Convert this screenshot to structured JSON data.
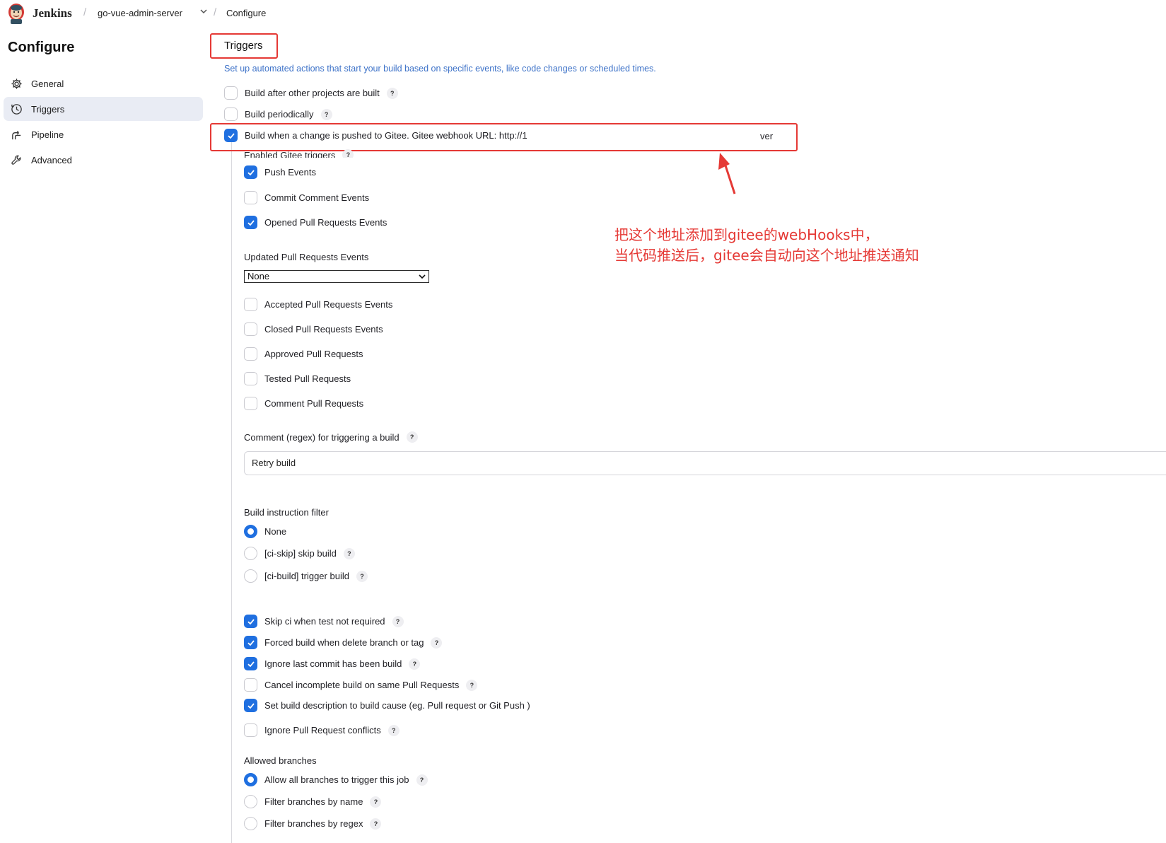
{
  "header": {
    "brand": "Jenkins",
    "project": "go-vue-admin-server",
    "page": "Configure"
  },
  "sidebar": {
    "title": "Configure",
    "items": [
      {
        "label": "General",
        "icon": "gear-icon"
      },
      {
        "label": "Triggers",
        "icon": "clock-icon",
        "active": true
      },
      {
        "label": "Pipeline",
        "icon": "pipeline-icon"
      },
      {
        "label": "Advanced",
        "icon": "wrench-icon"
      }
    ]
  },
  "triggers": {
    "title": "Triggers",
    "description": "Set up automated actions that start your build based on specific events, like code changes or scheduled times.",
    "build_after_other": "Build after other projects are built",
    "build_periodically": "Build periodically",
    "gitee_webhook": "Build when a change is pushed to Gitee. Gitee webhook URL: http://1",
    "gitee_webhook_tail": "ver",
    "enabled_triggers_label": "Enabled Gitee triggers",
    "push_events": "Push Events",
    "commit_comment_events": "Commit Comment Events",
    "opened_pr_events": "Opened Pull Requests Events",
    "updated_pr_label": "Updated Pull Requests Events",
    "updated_pr_value": "None",
    "accepted_pr": "Accepted Pull Requests Events",
    "closed_pr": "Closed Pull Requests Events",
    "approved_pr": "Approved Pull Requests",
    "tested_pr": "Tested Pull Requests",
    "comment_pr": "Comment Pull Requests",
    "comment_regex_label": "Comment (regex) for triggering a build",
    "comment_regex_value": "Retry build",
    "build_filter_label": "Build instruction filter",
    "filter_none": "None",
    "filter_ci_skip": "[ci-skip] skip build",
    "filter_ci_build": "[ci-build] trigger build",
    "skip_ci": "Skip ci when test not required",
    "forced_build": "Forced build when delete branch or tag",
    "ignore_last_commit": "Ignore last commit has been build",
    "cancel_incomplete": "Cancel incomplete build on same Pull Requests",
    "set_build_desc": "Set build description to build cause (eg. Pull request or Git Push )",
    "ignore_pr_conflicts": "Ignore Pull Request conflicts",
    "allowed_branches_label": "Allowed branches",
    "allow_all": "Allow all branches to trigger this job",
    "filter_by_name": "Filter branches by name",
    "filter_by_regex": "Filter branches by regex",
    "help": "?"
  },
  "annotation": {
    "line1": "把这个地址添加到gitee的webHooks中，",
    "line2": "当代码推送后，gitee会自动向这个地址推送通知"
  },
  "colors": {
    "accent": "#1f6fe0",
    "highlight": "#e53935",
    "description": "#3d72c8"
  }
}
